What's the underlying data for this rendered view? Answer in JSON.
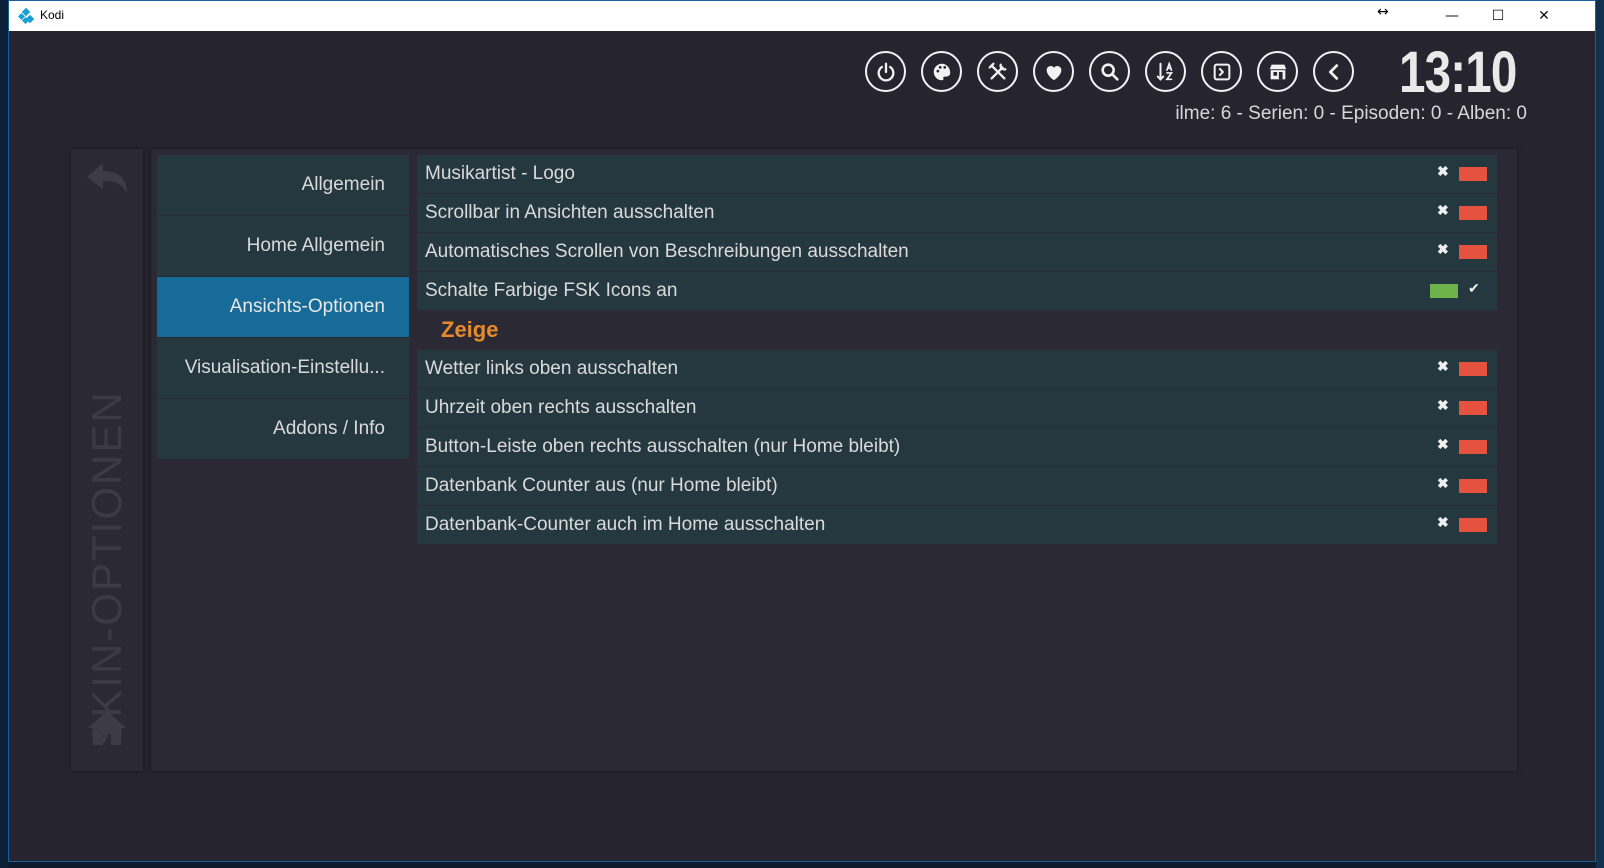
{
  "window": {
    "title": "Kodi",
    "resize_glyph": "↔",
    "minimize_glyph": "—",
    "maximize_glyph": "☐",
    "close_glyph": "✕"
  },
  "topbar": {
    "icons": [
      "power-icon",
      "paint-palette-icon",
      "tools-icon",
      "heart-icon",
      "search-icon",
      "sort-az-icon",
      "script-icon",
      "addons-store-icon",
      "back-chevron-icon"
    ],
    "clock": "13:10",
    "counter_text": "ilme: 6 - Serien: 0 - Episoden: 0 - Alben: 0"
  },
  "side_panel": {
    "vertical_title": "SKIN-OPTIONEN"
  },
  "menu": {
    "items": [
      {
        "label": "Allgemein",
        "active": false
      },
      {
        "label": "Home Allgemein",
        "active": false
      },
      {
        "label": "Ansichts-Optionen",
        "active": true
      },
      {
        "label": "Visualisation-Einstellu...",
        "active": false
      },
      {
        "label": "Addons / Info",
        "active": false
      }
    ]
  },
  "options": {
    "group1": [
      {
        "label": "Musikartist - Logo",
        "enabled": false
      },
      {
        "label": "Scrollbar in Ansichten ausschalten",
        "enabled": false
      },
      {
        "label": "Automatisches Scrollen von Beschreibungen ausschalten",
        "enabled": false
      },
      {
        "label": "Schalte Farbige FSK Icons an",
        "enabled": true
      }
    ],
    "section_heading": "Zeige",
    "group2": [
      {
        "label": "Wetter links oben ausschalten",
        "enabled": false
      },
      {
        "label": "Uhrzeit oben rechts ausschalten",
        "enabled": false
      },
      {
        "label": "Button-Leiste oben rechts ausschalten (nur Home bleibt)",
        "enabled": false
      },
      {
        "label": "Datenbank Counter aus (nur Home bleibt)",
        "enabled": false
      },
      {
        "label": "Datenbank-Counter auch im Home ausschalten",
        "enabled": false
      }
    ],
    "off_glyph": "✖",
    "on_glyph": "✔"
  },
  "colors": {
    "accent_active": "#176b98",
    "toggle_off": "#e5533f",
    "toggle_on": "#6db24a",
    "heading": "#e78a2c"
  }
}
